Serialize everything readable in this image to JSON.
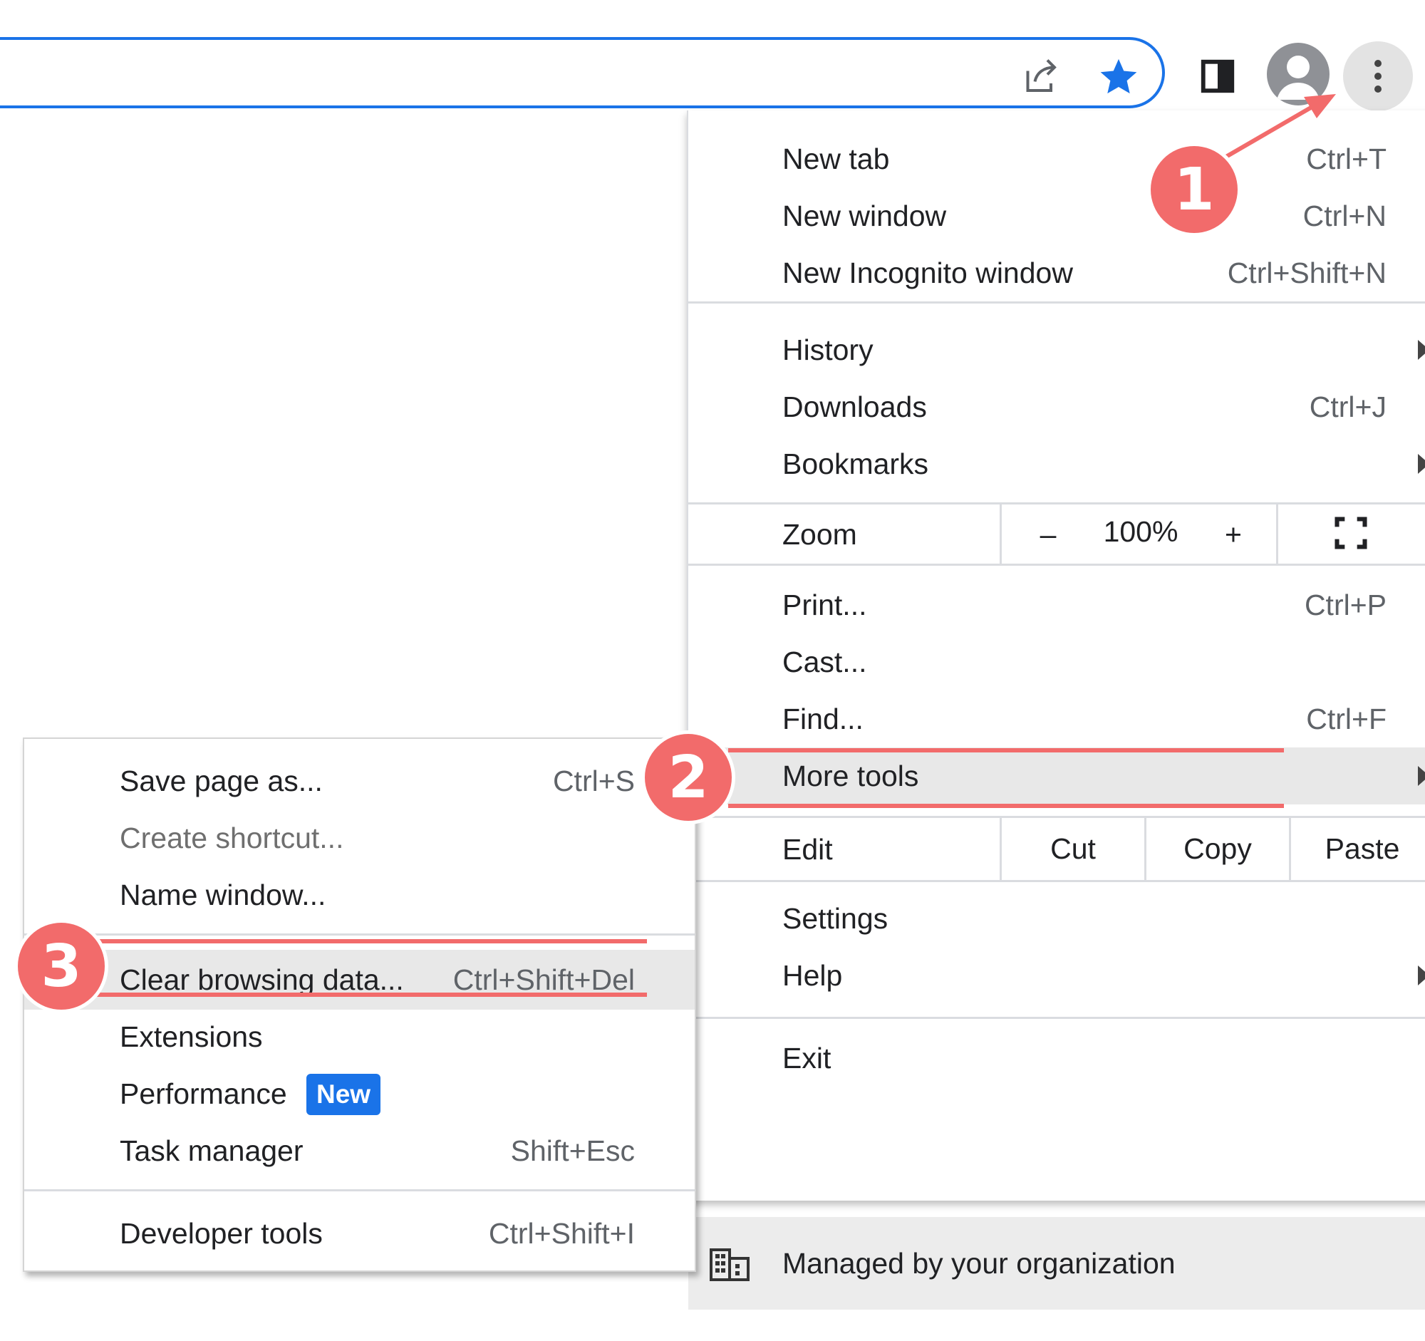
{
  "toolbar": {
    "icons": [
      "share-icon",
      "star-icon",
      "side-panel-icon",
      "profile-avatar",
      "more-icon"
    ],
    "accent": "#1a73e8"
  },
  "main_menu": {
    "new_tab": {
      "label": "New tab",
      "shortcut": "Ctrl+T"
    },
    "new_window": {
      "label": "New window",
      "shortcut": "Ctrl+N"
    },
    "new_incognito": {
      "label": "New Incognito window",
      "shortcut": "Ctrl+Shift+N"
    },
    "history": {
      "label": "History"
    },
    "downloads": {
      "label": "Downloads",
      "shortcut": "Ctrl+J"
    },
    "bookmarks": {
      "label": "Bookmarks"
    },
    "zoom": {
      "label": "Zoom",
      "minus": "–",
      "value": "100%",
      "plus": "+"
    },
    "print": {
      "label": "Print...",
      "shortcut": "Ctrl+P"
    },
    "cast": {
      "label": "Cast..."
    },
    "find": {
      "label": "Find...",
      "shortcut": "Ctrl+F"
    },
    "more_tools": {
      "label": "More tools"
    },
    "edit": {
      "label": "Edit",
      "cut": "Cut",
      "copy": "Copy",
      "paste": "Paste"
    },
    "settings": {
      "label": "Settings"
    },
    "help": {
      "label": "Help"
    },
    "exit": {
      "label": "Exit"
    },
    "managed": {
      "label": "Managed by your organization"
    }
  },
  "more_tools_menu": {
    "save_page": {
      "label": "Save page as...",
      "shortcut": "Ctrl+S"
    },
    "create_shortcut": {
      "label": "Create shortcut..."
    },
    "name_window": {
      "label": "Name window..."
    },
    "clear_browsing": {
      "label": "Clear browsing data...",
      "shortcut": "Ctrl+Shift+Del"
    },
    "extensions": {
      "label": "Extensions"
    },
    "performance": {
      "label": "Performance",
      "badge": "New"
    },
    "task_manager": {
      "label": "Task manager",
      "shortcut": "Shift+Esc"
    },
    "developer_tools": {
      "label": "Developer tools",
      "shortcut": "Ctrl+Shift+I"
    }
  },
  "annotations": {
    "step1": "1",
    "step2": "2",
    "step3": "3",
    "color": "#f26b6b"
  }
}
